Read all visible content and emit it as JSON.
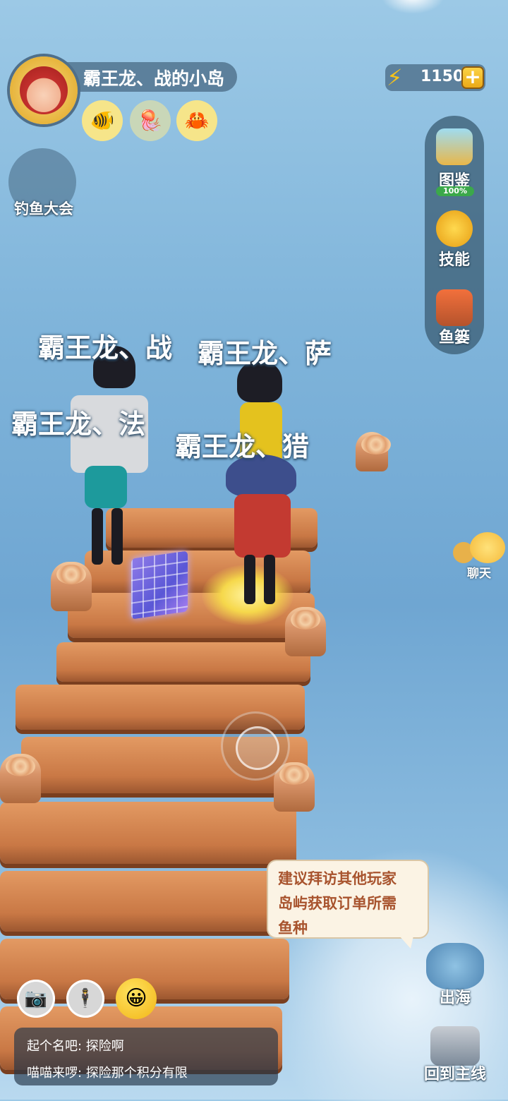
{
  "profile": {
    "island_name": "霸王龙、战的小岛"
  },
  "fish_slots": [
    {
      "icon": "clownfish-icon",
      "glyph": "🐠",
      "color": "#f6e58a"
    },
    {
      "icon": "jellyfish-icon",
      "glyph": "🪼",
      "color": "#c9d7b8"
    },
    {
      "icon": "crab-icon",
      "glyph": "🦀",
      "color": "#f6e58a"
    }
  ],
  "currency": {
    "value": "1150",
    "plus": "+"
  },
  "events": {
    "fishing_contest": "钓鱼大会"
  },
  "right_menu": {
    "collection": {
      "label": "图鉴",
      "progress": "100%"
    },
    "skills": {
      "label": "技能"
    },
    "basket": {
      "label": "鱼篓"
    }
  },
  "players": [
    "霸王龙、战",
    "霸王龙、萨",
    "霸王龙、法",
    "霸王龙、猎"
  ],
  "chat_button": "聊天",
  "tip": {
    "lines": [
      "建议拜访其他玩家",
      "岛屿获取订单所需",
      "鱼种"
    ]
  },
  "bottom_icons": {
    "camera": "📷",
    "emote": "😀"
  },
  "chat_log": [
    {
      "text": "起个名吧: 探险啊"
    },
    {
      "text": "喵喵来啰: 探险那个积分有限"
    }
  ],
  "actions": {
    "go_sea": "出海",
    "back_main": "回到主线"
  }
}
